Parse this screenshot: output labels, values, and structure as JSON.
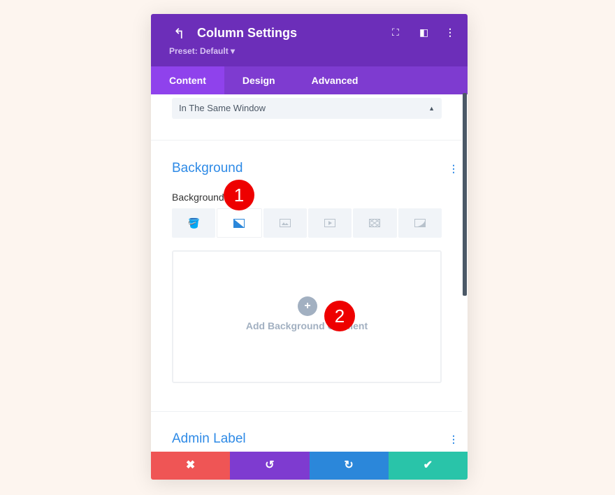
{
  "header": {
    "title": "Column Settings",
    "preset": "Preset: Default ▾"
  },
  "tabs": [
    {
      "label": "Content"
    },
    {
      "label": "Design"
    },
    {
      "label": "Advanced"
    }
  ],
  "link_target": {
    "value": "In The Same Window"
  },
  "background": {
    "section_title": "Background",
    "field_label": "Background",
    "active_tab": "gradient",
    "tabs": [
      "color",
      "gradient",
      "image",
      "video",
      "pattern",
      "mask"
    ],
    "add_gradient_label": "Add Background Gradient"
  },
  "admin_label": {
    "section_title": "Admin Label"
  },
  "annotations": [
    "1",
    "2"
  ],
  "footer": {
    "buttons": [
      "cancel",
      "undo",
      "redo",
      "save"
    ]
  },
  "colors": {
    "header": "#6c2eb9",
    "tabs": "#7e3bd0",
    "accent": "#2e8ae6",
    "cancel": "#ef5555",
    "undo": "#7e3bd0",
    "redo": "#2b87da",
    "save": "#29c4a9"
  }
}
